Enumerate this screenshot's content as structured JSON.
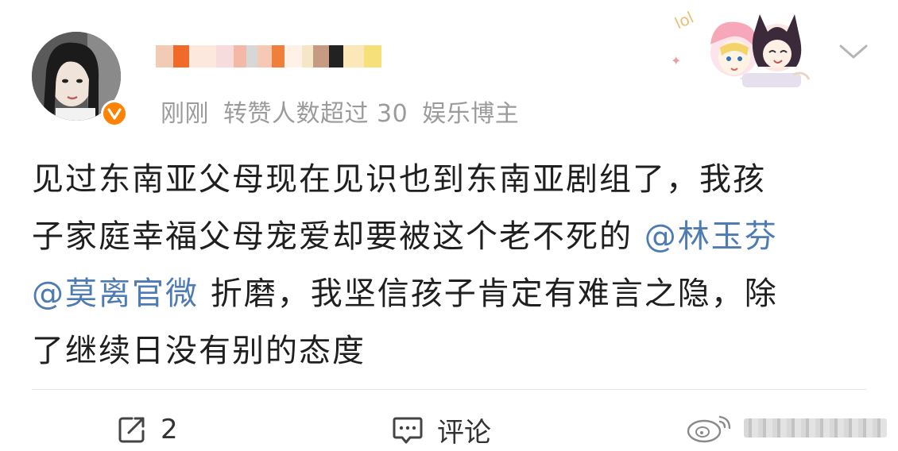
{
  "post": {
    "meta": {
      "time": "刚刚",
      "repost_note": "转赞人数超过 30",
      "user_tag": "娱乐博主"
    },
    "body": {
      "line1": "见过东南亚父母现在见识也到东南亚剧组了，我孩",
      "line2_text": "子家庭幸福父母宠爱却要被这个老不死的 ",
      "mention1": "@林玉芬",
      "mention2": "@莫离官微",
      "line3_text": " 折磨，我坚信孩子肯定有难言之隐，除",
      "line4": "了继续日没有别的态度"
    },
    "actions": {
      "repost_count": "2",
      "comment_label": "评论"
    }
  },
  "colors": {
    "verified_badge": "#ff8200",
    "mention": "#4f7bb3",
    "meta_text": "#9b9b9b"
  },
  "icons": {
    "verified": "verified-v-icon",
    "menu": "chevron-down-icon",
    "repost": "share-icon",
    "comment": "comment-icon",
    "watermark": "weibo-logo-icon"
  }
}
